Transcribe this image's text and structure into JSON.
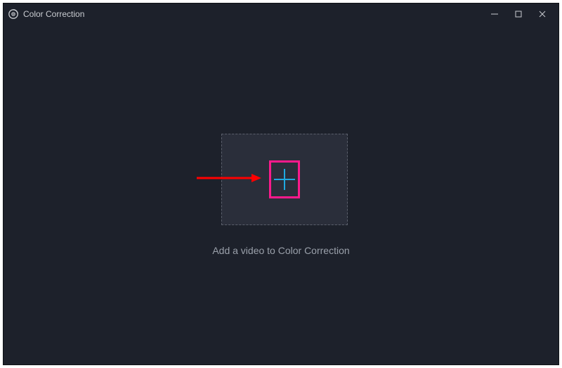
{
  "window": {
    "title": "Color Correction"
  },
  "main": {
    "hint": "Add a video to Color Correction"
  },
  "colors": {
    "accent_plus": "#1fa9e0",
    "annotation_pink": "#ff1a8c",
    "annotation_red": "#ff0000"
  }
}
